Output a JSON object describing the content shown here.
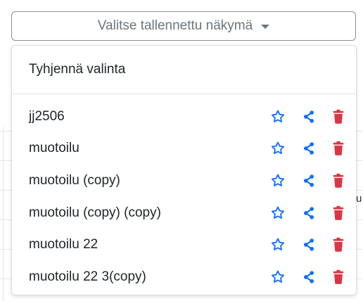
{
  "select": {
    "label": "Valitse tallennettu näkymä"
  },
  "menu": {
    "clear_label": "Tyhjennä valinta",
    "items": [
      {
        "label": "jj2506"
      },
      {
        "label": "muotoilu"
      },
      {
        "label": "muotoilu (copy)"
      },
      {
        "label": "muotoilu (copy) (copy)"
      },
      {
        "label": "muotoilu 22"
      },
      {
        "label": "muotoilu 22 3(copy)"
      }
    ]
  },
  "background": {
    "fragment_text": "u"
  },
  "icons": {
    "star": "star-outline-icon",
    "share": "share-icon",
    "delete": "trash-icon"
  },
  "colors": {
    "accent": "#0d6efd",
    "danger": "#dc3545",
    "text": "#212529",
    "muted": "#6c757d"
  }
}
